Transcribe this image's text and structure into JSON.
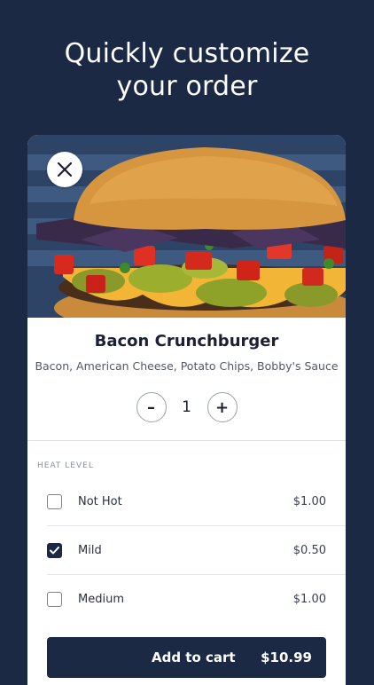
{
  "headline": {
    "line1": "Quickly customize",
    "line2": "your order"
  },
  "colors": {
    "background": "#1b2945",
    "accent": "#1b2945",
    "card": "#ffffff"
  },
  "product": {
    "name": "Bacon Crunchburger",
    "description": "Bacon, American Cheese, Potato Chips, Bobby's Sauce",
    "image_icon": "burger-photo",
    "quantity": "1",
    "decrement_label": "–",
    "increment_label": "+"
  },
  "section": {
    "label": "HEAT LEVEL"
  },
  "options": [
    {
      "label": "Not Hot",
      "price": "$1.00",
      "checked": false
    },
    {
      "label": "Mild",
      "price": "$0.50",
      "checked": true
    },
    {
      "label": "Medium",
      "price": "$1.00",
      "checked": false
    }
  ],
  "cart": {
    "label": "Add to cart",
    "total": "$10.99"
  }
}
